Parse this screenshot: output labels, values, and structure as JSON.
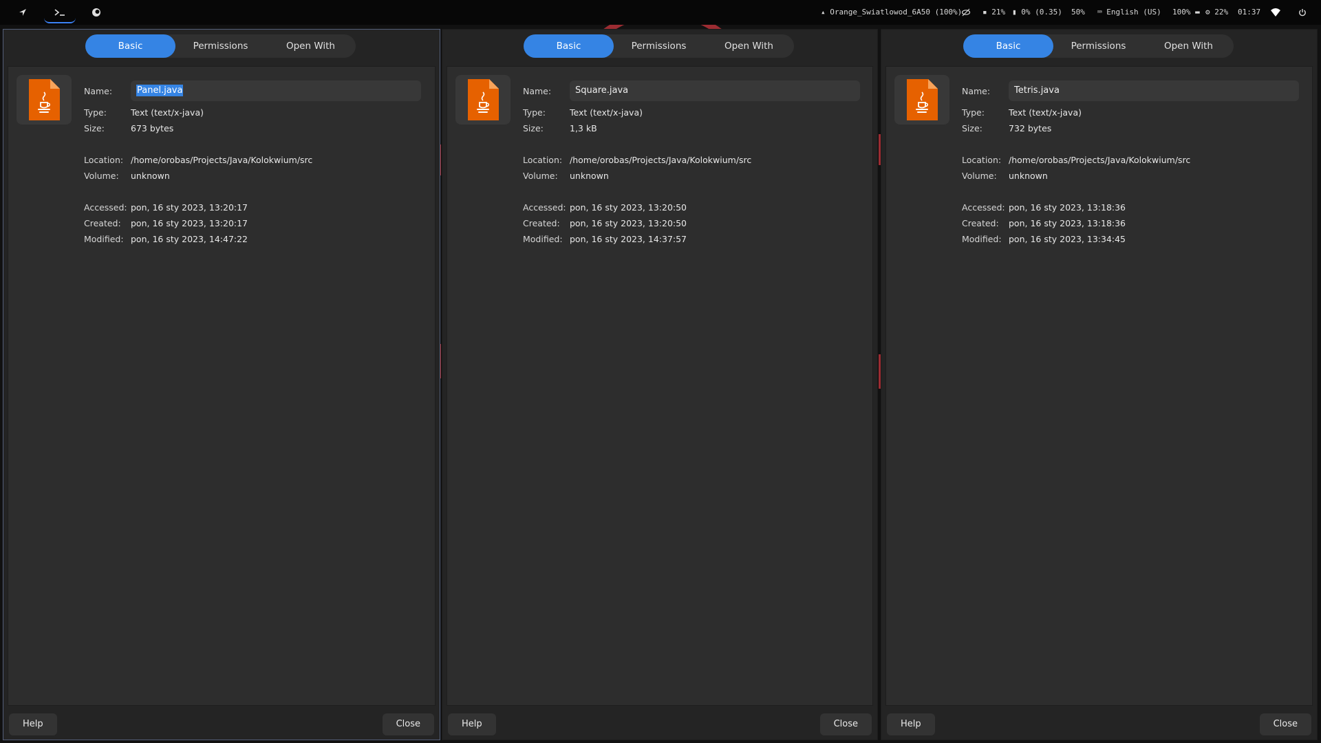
{
  "topbar": {
    "workspaces": [
      "workspace-1",
      "terminal",
      "browser"
    ],
    "network": "Orange_Swiatlowod_6A50 (100%)",
    "cpu": "21%",
    "memory": "0% (0.35)",
    "brightness": "50%",
    "keyboard_layout": "English (US)",
    "volume": "100%",
    "temperature": "22%",
    "clock": "01:37"
  },
  "tab_labels": [
    "Basic",
    "Permissions",
    "Open With"
  ],
  "field_labels": {
    "name": "Name:",
    "type": "Type:",
    "size": "Size:",
    "location": "Location:",
    "volume": "Volume:",
    "accessed": "Accessed:",
    "created": "Created:",
    "modified": "Modified:"
  },
  "buttons": {
    "help": "Help",
    "close": "Close"
  },
  "dialogs": [
    {
      "name": "Panel.java",
      "type": "Text (text/x-java)",
      "size": "673 bytes",
      "location": "/home/orobas/Projects/Java/Kolokwium/src",
      "volume": "unknown",
      "accessed": "pon, 16 sty 2023, 13:20:17",
      "created": "pon, 16 sty 2023, 13:20:17",
      "modified": "pon, 16 sty 2023, 14:47:22"
    },
    {
      "name": "Square.java",
      "type": "Text (text/x-java)",
      "size": "1,3 kB",
      "location": "/home/orobas/Projects/Java/Kolokwium/src",
      "volume": "unknown",
      "accessed": "pon, 16 sty 2023, 13:20:50",
      "created": "pon, 16 sty 2023, 13:20:50",
      "modified": "pon, 16 sty 2023, 14:37:57"
    },
    {
      "name": "Tetris.java",
      "type": "Text (text/x-java)",
      "size": "732 bytes",
      "location": "/home/orobas/Projects/Java/Kolokwium/src",
      "volume": "unknown",
      "accessed": "pon, 16 sty 2023, 13:18:36",
      "created": "pon, 16 sty 2023, 13:18:36",
      "modified": "pon, 16 sty 2023, 13:34:45"
    }
  ],
  "colors": {
    "accent": "#3584e4",
    "icon": "#e66100",
    "wallpaper_accent": "#9b2c32"
  }
}
